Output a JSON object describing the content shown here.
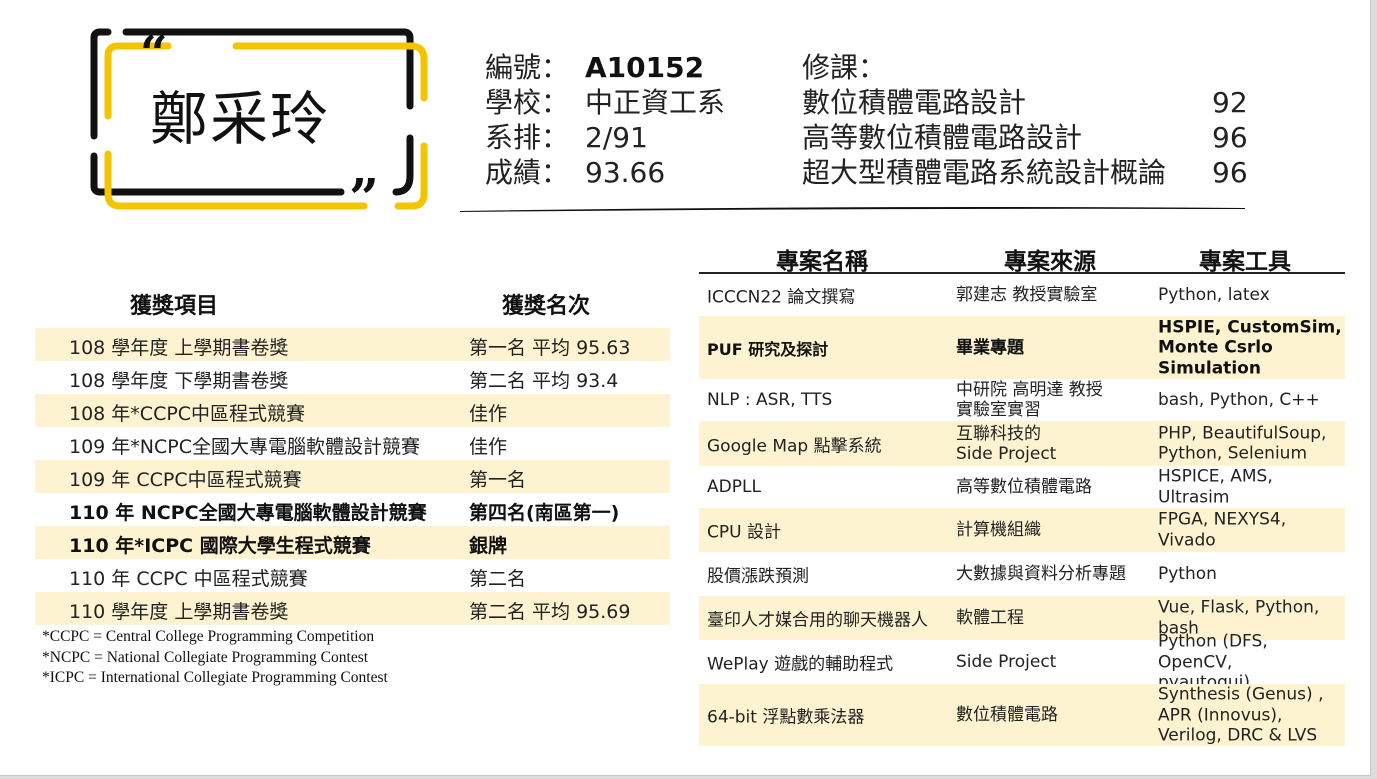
{
  "profile": {
    "name": "鄭采玲",
    "open_quote": "“",
    "close_quote": "„",
    "info": [
      {
        "label": "編號：",
        "value": "A10152"
      },
      {
        "label": "學校：",
        "value": "中正資工系"
      },
      {
        "label": "系排：",
        "value": "2/91"
      },
      {
        "label": "成績：",
        "value": "93.66"
      }
    ]
  },
  "courses": {
    "title": "修課：",
    "items": [
      {
        "name": "數位積體電路設計",
        "score": "92"
      },
      {
        "name": "高等數位積體電路設計",
        "score": "96"
      },
      {
        "name": "超大型積體電路系統設計概論",
        "score": "96"
      }
    ]
  },
  "awards": {
    "headers": {
      "item": "獲獎項目",
      "rank": "獲獎名次"
    },
    "rows": [
      {
        "item": "108 學年度 上學期書卷獎",
        "rank": "第一名 平均 95.63"
      },
      {
        "item": "108 學年度 下學期書卷獎",
        "rank": "第二名 平均 93.4"
      },
      {
        "item": "108 年*CCPC中區程式競賽",
        "rank": "佳作"
      },
      {
        "item": "109 年*NCPC全國大專電腦軟體設計競賽",
        "rank": "佳作"
      },
      {
        "item": "109 年 CCPC中區程式競賽",
        "rank": "第一名"
      },
      {
        "item": "110 年 NCPC全國大專電腦軟體設計競賽",
        "rank": "第四名(南區第一)"
      },
      {
        "item": "110 年*ICPC 國際大學生程式競賽",
        "rank": "銀牌"
      },
      {
        "item": "110 年 CCPC 中區程式競賽",
        "rank": "第二名"
      },
      {
        "item": "110 學年度 上學期書卷獎",
        "rank": "第二名 平均 95.69"
      }
    ],
    "notes": [
      "*CCPC = Central College Programming Competition",
      "*NCPC = National Collegiate Programming Contest",
      "*ICPC = International Collegiate Programming Contest"
    ]
  },
  "projects": {
    "headers": {
      "name": "專案名稱",
      "source": "專案來源",
      "tools": "專案工具"
    },
    "rows": [
      {
        "name": "ICCCN22 論文撰寫",
        "source": [
          "郭建志 教授實驗室"
        ],
        "tools": [
          "Python, latex"
        ]
      },
      {
        "name": "PUF 研究及探討",
        "source": [
          "畢業專題"
        ],
        "tools": [
          "HSPIE, CustomSim,",
          "Monte Csrlo",
          "Simulation"
        ]
      },
      {
        "name": "NLP : ASR, TTS",
        "source": [
          "中研院 高明達 教授",
          "實驗室實習"
        ],
        "tools": [
          "bash, Python, C++"
        ]
      },
      {
        "name": "Google Map 點擊系統",
        "source": [
          "互聯科技的",
          "Side Project"
        ],
        "tools": [
          "PHP, BeautifulSoup,",
          "Python, Selenium"
        ]
      },
      {
        "name": "ADPLL",
        "source": [
          "高等數位積體電路"
        ],
        "tools": [
          "HSPICE, AMS, Ultrasim"
        ]
      },
      {
        "name": "CPU 設計",
        "source": [
          "計算機組織"
        ],
        "tools": [
          "FPGA, NEXYS4, Vivado"
        ]
      },
      {
        "name": "股價漲跌預測",
        "source": [
          "大數據與資料分析專題"
        ],
        "tools": [
          "Python"
        ]
      },
      {
        "name": "臺印人才媒合用的聊天機器人",
        "source": [
          "軟體工程"
        ],
        "tools": [
          "Vue, Flask, Python,",
          "bash"
        ]
      },
      {
        "name": "WePlay 遊戲的輔助程式",
        "source": [
          "Side Project"
        ],
        "tools": [
          "Python (DFS, OpenCV,",
          "pyautogui)"
        ]
      },
      {
        "name": "64-bit 浮點數乘法器",
        "source": [
          "數位積體電路"
        ],
        "tools": [
          "Synthesis (Genus) ,",
          "APR (Innovus),",
          "Verilog, DRC & LVS"
        ]
      }
    ]
  },
  "colors": {
    "accent": "#f5c400",
    "frame_dark": "#111111",
    "row_highlight": "#fdf3d1"
  }
}
